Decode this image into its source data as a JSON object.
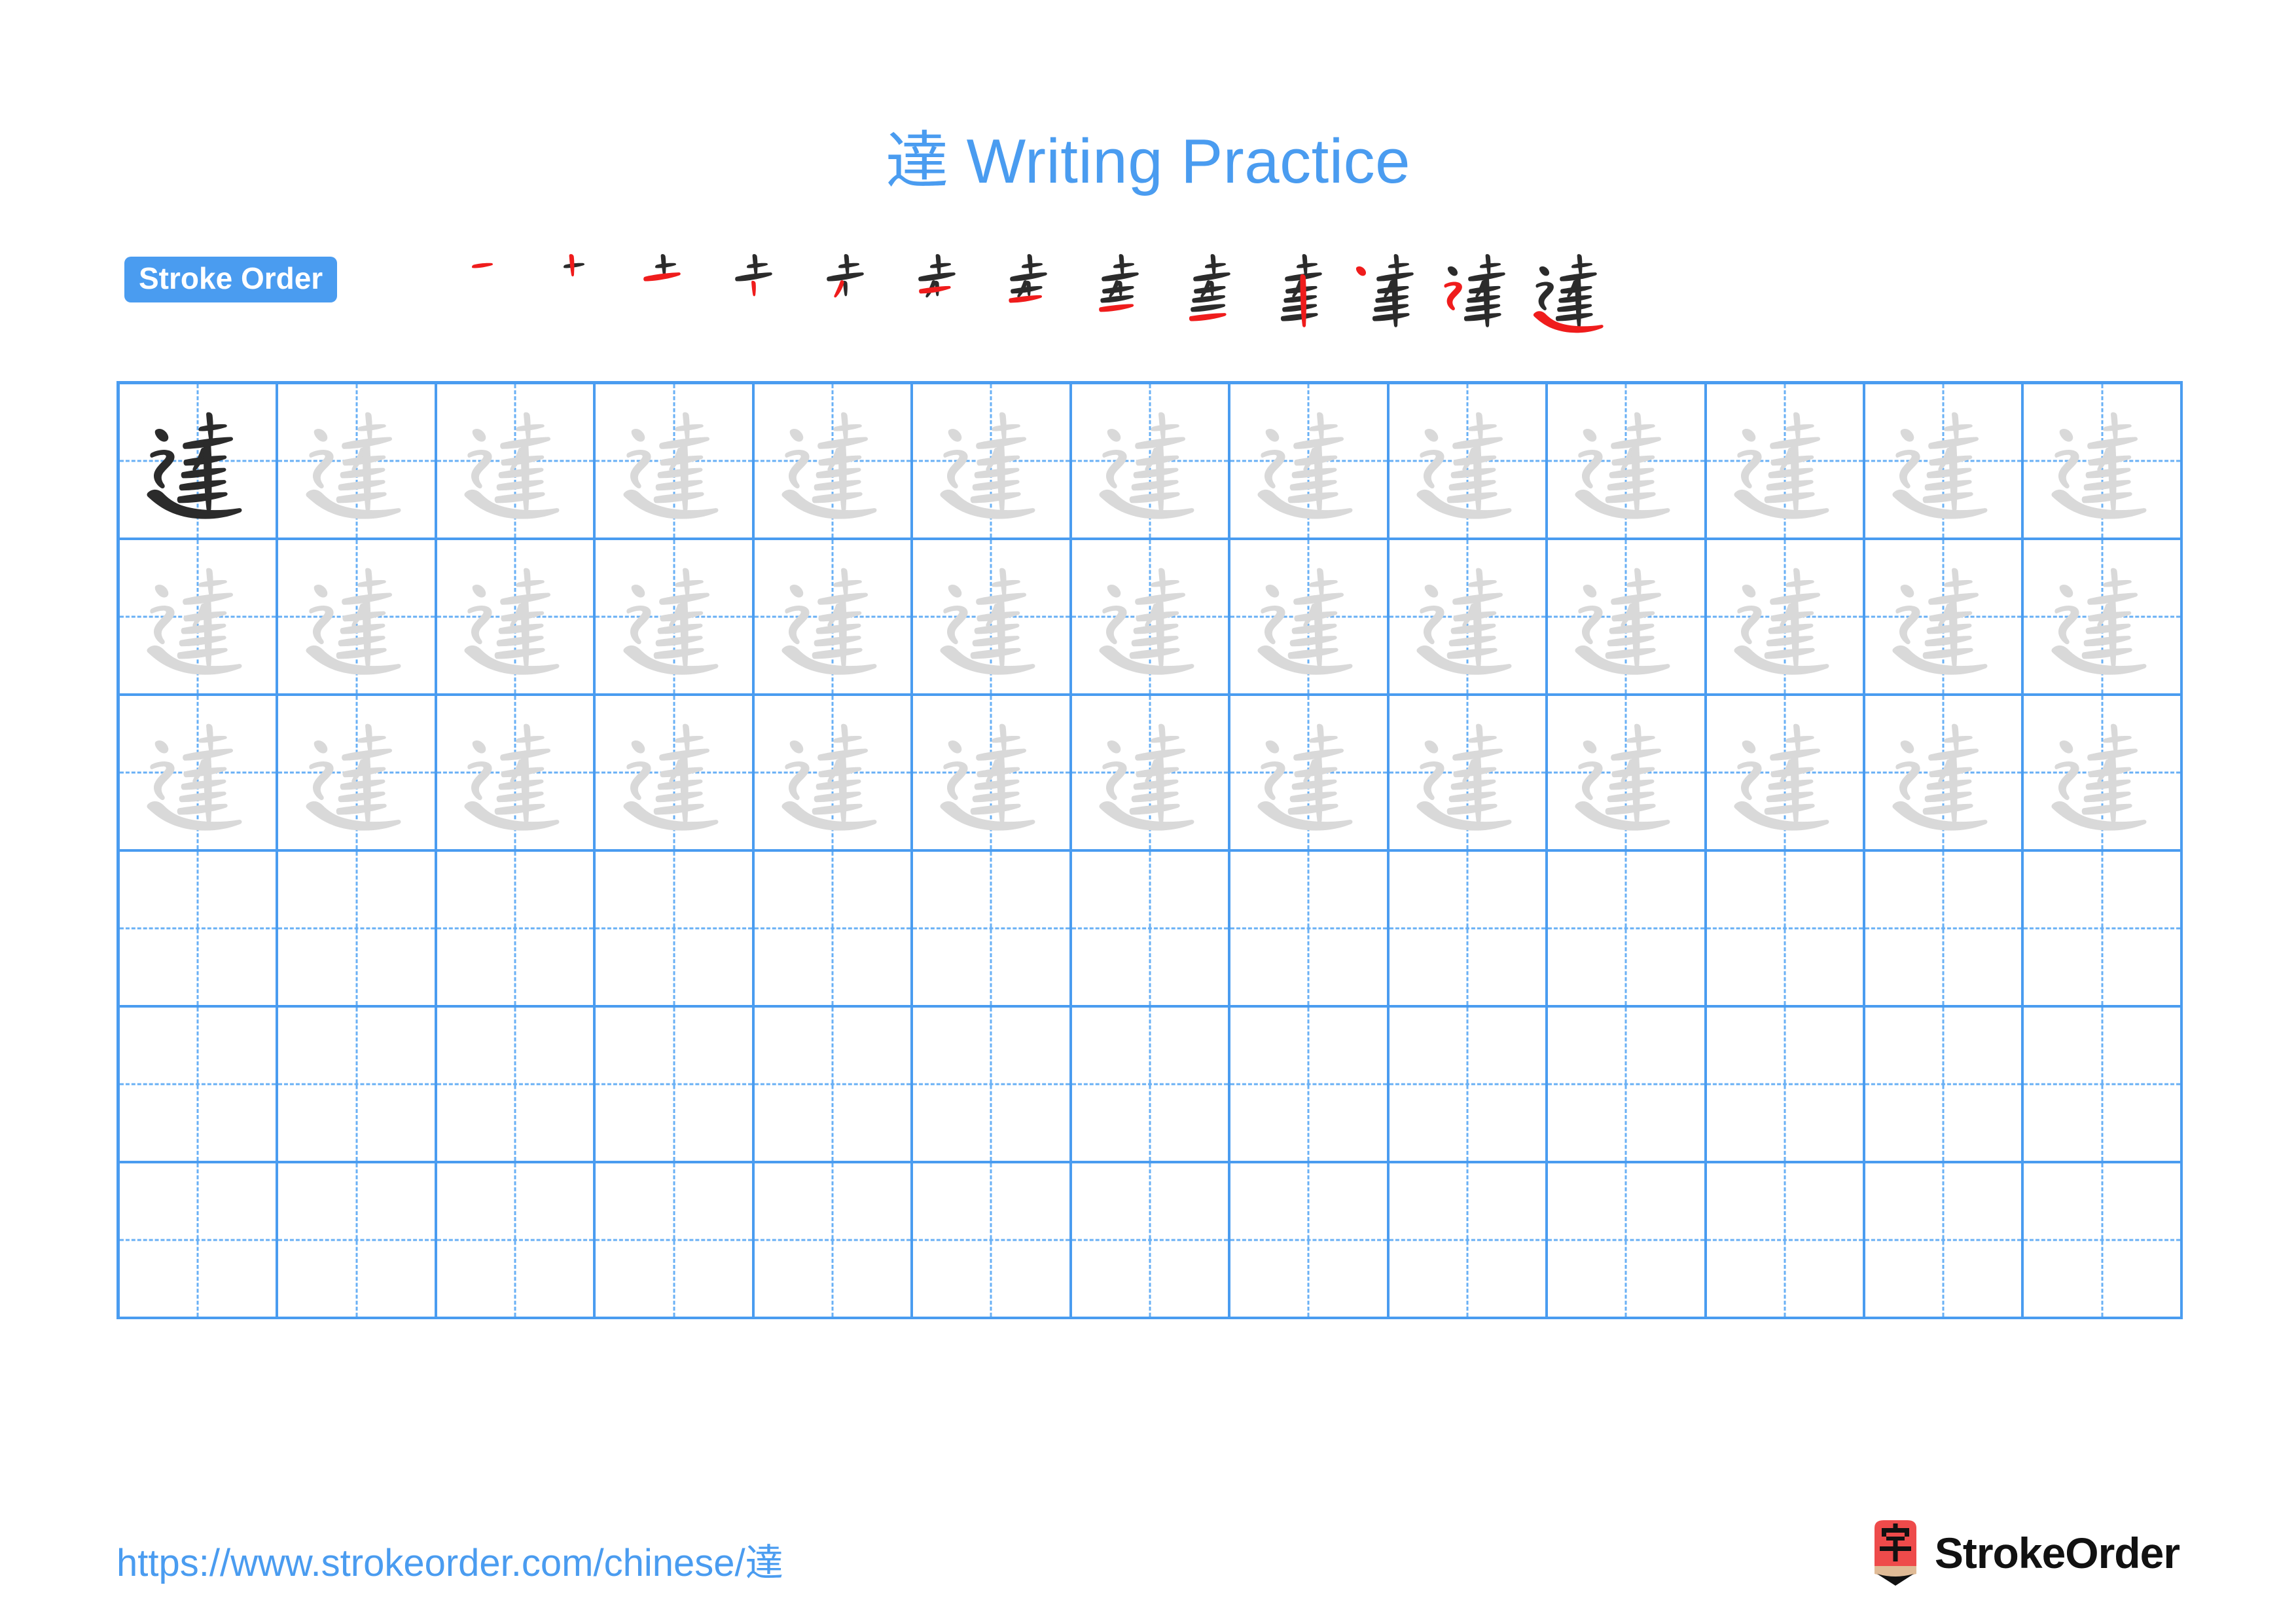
{
  "page": {
    "character": "達",
    "title": "達 Writing Practice",
    "title_suffix": " Writing Practice",
    "accent_color": "#4a9cf0",
    "grid_line_color": "#4a9cf0",
    "guide_line_color": "#69b0f5",
    "trace_color": "#d9d9d9",
    "model_color": "#2b2b2b",
    "new_stroke_color": "#ef1c1c"
  },
  "stroke_order": {
    "label": "Stroke Order",
    "total_strokes": 13,
    "steps": [
      {
        "index": 1,
        "new_stroke": "horizontal (一)"
      },
      {
        "index": 2,
        "new_stroke": "vertical (丨)"
      },
      {
        "index": 3,
        "new_stroke": "horizontal (一)"
      },
      {
        "index": 4,
        "new_stroke": "short vertical (丨)"
      },
      {
        "index": 5,
        "new_stroke": "left-falling (丿)"
      },
      {
        "index": 6,
        "new_stroke": "horizontal (一)"
      },
      {
        "index": 7,
        "new_stroke": "horizontal (一)"
      },
      {
        "index": 8,
        "new_stroke": "horizontal (一)"
      },
      {
        "index": 9,
        "new_stroke": "horizontal (一)"
      },
      {
        "index": 10,
        "new_stroke": "vertical (丨)"
      },
      {
        "index": 11,
        "new_stroke": "dot (丶)"
      },
      {
        "index": 12,
        "new_stroke": "horizontal-fold-fold (㇇)"
      },
      {
        "index": 13,
        "new_stroke": "sweeping press (辶)"
      }
    ]
  },
  "grid": {
    "columns": 13,
    "rows": 6,
    "rows_detail": [
      {
        "row": 1,
        "cells": [
          "model",
          "trace",
          "trace",
          "trace",
          "trace",
          "trace",
          "trace",
          "trace",
          "trace",
          "trace",
          "trace",
          "trace",
          "trace"
        ]
      },
      {
        "row": 2,
        "cells": [
          "trace",
          "trace",
          "trace",
          "trace",
          "trace",
          "trace",
          "trace",
          "trace",
          "trace",
          "trace",
          "trace",
          "trace",
          "trace"
        ]
      },
      {
        "row": 3,
        "cells": [
          "trace",
          "trace",
          "trace",
          "trace",
          "trace",
          "trace",
          "trace",
          "trace",
          "trace",
          "trace",
          "trace",
          "trace",
          "trace"
        ]
      },
      {
        "row": 4,
        "cells": [
          "empty",
          "empty",
          "empty",
          "empty",
          "empty",
          "empty",
          "empty",
          "empty",
          "empty",
          "empty",
          "empty",
          "empty",
          "empty"
        ]
      },
      {
        "row": 5,
        "cells": [
          "empty",
          "empty",
          "empty",
          "empty",
          "empty",
          "empty",
          "empty",
          "empty",
          "empty",
          "empty",
          "empty",
          "empty",
          "empty"
        ]
      },
      {
        "row": 6,
        "cells": [
          "empty",
          "empty",
          "empty",
          "empty",
          "empty",
          "empty",
          "empty",
          "empty",
          "empty",
          "empty",
          "empty",
          "empty",
          "empty"
        ]
      }
    ]
  },
  "footer": {
    "url": "https://www.strokeorder.com/chinese/達",
    "logo_text": "StrokeOrder",
    "logo_glyph": "字",
    "logo_body_color": "#ee4b4b",
    "logo_wood_color": "#e0bb96",
    "logo_tip_color": "#111111"
  }
}
